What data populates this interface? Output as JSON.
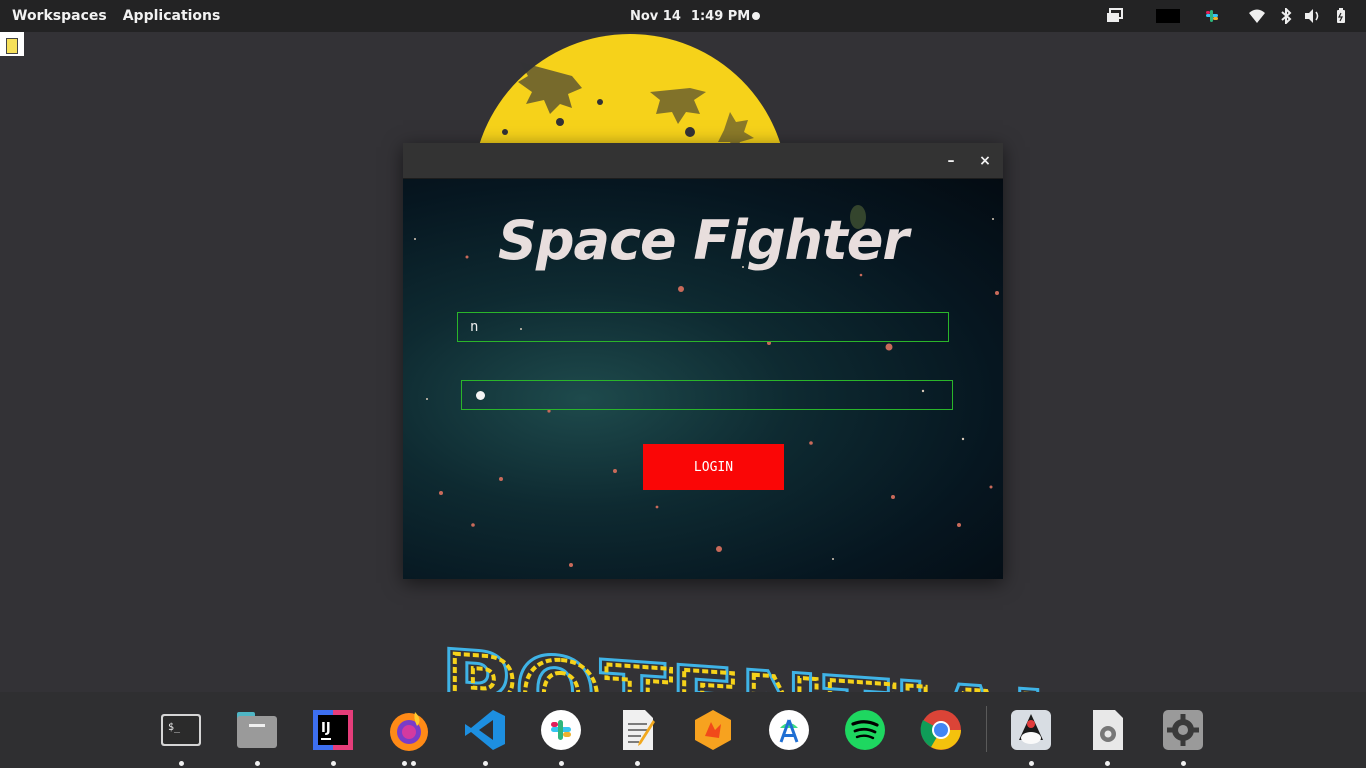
{
  "topbar": {
    "workspaces_label": "Workspaces",
    "applications_label": "Applications",
    "date": "Nov 14",
    "time": "1:49 PM",
    "tray_icons": [
      "screen-share-icon",
      "color-swatch-icon",
      "slack-tray-icon",
      "wifi-icon",
      "bluetooth-icon",
      "volume-icon",
      "battery-icon"
    ]
  },
  "wallpaper": {
    "text": "POTENTIAL",
    "colors": {
      "moon": "#f6d21a",
      "accent_blue": "#3fb3e6"
    }
  },
  "window": {
    "minimize_label": "–",
    "close_label": "×",
    "game_title": "Space Fighter",
    "username_value": "n",
    "password_masked": true,
    "login_label": "LOGIN",
    "colors": {
      "field_border": "#2ab52a",
      "login_bg": "#fa0606",
      "title_color": "#e8dedd"
    }
  },
  "dock": {
    "items": [
      {
        "name": "terminal-app-icon",
        "label": "$_"
      },
      {
        "name": "files-app-icon",
        "label": ""
      },
      {
        "name": "intellij-app-icon",
        "label": "IJ"
      },
      {
        "name": "firefox-app-icon",
        "label": ""
      },
      {
        "name": "vscode-app-icon",
        "label": ""
      },
      {
        "name": "slack-app-icon",
        "label": ""
      },
      {
        "name": "text-editor-app-icon",
        "label": ""
      },
      {
        "name": "postman-app-icon",
        "label": ""
      },
      {
        "name": "android-studio-app-icon",
        "label": ""
      },
      {
        "name": "spotify-app-icon",
        "label": ""
      },
      {
        "name": "chrome-app-icon",
        "label": ""
      },
      {
        "name": "java-app-icon",
        "label": ""
      },
      {
        "name": "java-config-app-icon",
        "label": ""
      },
      {
        "name": "settings-app-icon",
        "label": ""
      }
    ]
  }
}
